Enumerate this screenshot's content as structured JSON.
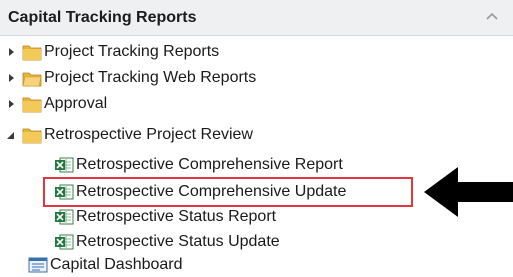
{
  "panel": {
    "title": "Capital Tracking Reports"
  },
  "tree": {
    "items": [
      {
        "label": "Project Tracking Reports",
        "icon": "folder-icon"
      },
      {
        "label": "Project Tracking Web Reports",
        "icon": "web-folder-icon"
      },
      {
        "label": "Approval",
        "icon": "folder-icon"
      },
      {
        "label": "Retrospective Project Review",
        "icon": "folder-icon"
      }
    ],
    "children": [
      {
        "label": "Retrospective Comprehensive Report",
        "icon": "excel-report-icon"
      },
      {
        "label": "Retrospective Comprehensive Update",
        "icon": "excel-report-icon"
      },
      {
        "label": "Retrospective Status Report",
        "icon": "excel-report-icon"
      },
      {
        "label": "Retrospective Status Update",
        "icon": "excel-report-icon"
      }
    ],
    "dashboard": {
      "label": "Capital Dashboard",
      "icon": "dashboard-icon"
    }
  },
  "colors": {
    "highlight": "#e0363d",
    "folder": "#e8b53a",
    "excel": "#1f7a3f"
  }
}
